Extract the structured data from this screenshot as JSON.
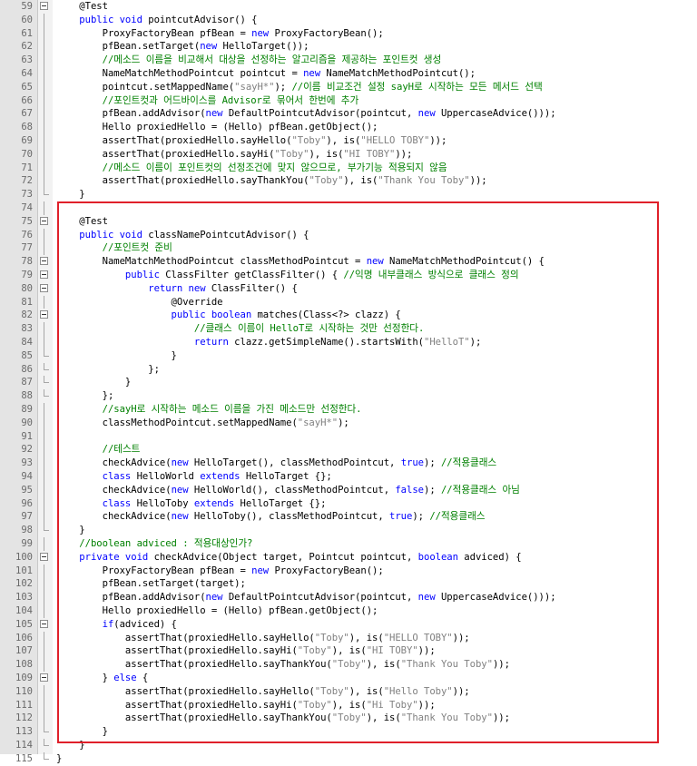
{
  "editor": {
    "highlight_color": "#e0202a",
    "colors": {
      "keyword": "#0000ff",
      "string": "#808080",
      "comment": "#008000",
      "gutter": "#e4e4e4"
    },
    "lines": [
      {
        "n": "59",
        "fold": "mark",
        "t": [
          [
            "ann",
            "    @Test"
          ]
        ]
      },
      {
        "n": "60",
        "fold": "line",
        "t": [
          [
            "kw",
            "    public void "
          ],
          [
            "plain",
            "pointcutAdvisor() {"
          ]
        ]
      },
      {
        "n": "61",
        "fold": "line",
        "t": [
          [
            "plain",
            "        ProxyFactoryBean pfBean = "
          ],
          [
            "kw",
            "new "
          ],
          [
            "plain",
            "ProxyFactoryBean();"
          ]
        ]
      },
      {
        "n": "62",
        "fold": "line",
        "t": [
          [
            "plain",
            "        pfBean.setTarget("
          ],
          [
            "kw",
            "new "
          ],
          [
            "plain",
            "HelloTarget());"
          ]
        ]
      },
      {
        "n": "63",
        "fold": "line",
        "t": [
          [
            "cmt",
            "        //메소드 이름을 비교해서 대상을 선정하는 알고리즘을 제공하는 포인트컷 생성"
          ]
        ]
      },
      {
        "n": "64",
        "fold": "line",
        "t": [
          [
            "plain",
            "        NameMatchMethodPointcut pointcut = "
          ],
          [
            "kw",
            "new "
          ],
          [
            "plain",
            "NameMatchMethodPointcut();"
          ]
        ]
      },
      {
        "n": "65",
        "fold": "line",
        "t": [
          [
            "plain",
            "        pointcut.setMappedName("
          ],
          [
            "str",
            "\"sayH*\""
          ],
          [
            "plain",
            "); "
          ],
          [
            "cmt",
            "//이름 비교조건 설정 sayH로 시작하는 모든 메서드 선택"
          ]
        ]
      },
      {
        "n": "66",
        "fold": "line",
        "t": [
          [
            "cmt",
            "        //포인트컷과 어드바이스를 Advisor로 묶어서 한번에 추가"
          ]
        ]
      },
      {
        "n": "67",
        "fold": "line",
        "t": [
          [
            "plain",
            "        pfBean.addAdvisor("
          ],
          [
            "kw",
            "new "
          ],
          [
            "plain",
            "DefaultPointcutAdvisor(pointcut, "
          ],
          [
            "kw",
            "new "
          ],
          [
            "plain",
            "UppercaseAdvice()));"
          ]
        ]
      },
      {
        "n": "68",
        "fold": "line",
        "t": [
          [
            "plain",
            "        Hello proxiedHello = (Hello) pfBean.getObject();"
          ]
        ]
      },
      {
        "n": "69",
        "fold": "line",
        "t": [
          [
            "plain",
            "        assertThat(proxiedHello.sayHello("
          ],
          [
            "str",
            "\"Toby\""
          ],
          [
            "plain",
            "), is("
          ],
          [
            "str",
            "\"HELLO TOBY\""
          ],
          [
            "plain",
            "));"
          ]
        ]
      },
      {
        "n": "70",
        "fold": "line",
        "t": [
          [
            "plain",
            "        assertThat(proxiedHello.sayHi("
          ],
          [
            "str",
            "\"Toby\""
          ],
          [
            "plain",
            "), is("
          ],
          [
            "str",
            "\"HI TOBY\""
          ],
          [
            "plain",
            "));"
          ]
        ]
      },
      {
        "n": "71",
        "fold": "line",
        "t": [
          [
            "cmt",
            "        //메소드 이름이 포인트컷의 선정조건에 맞지 않으므로, 부가기능 적용되지 않음"
          ]
        ]
      },
      {
        "n": "72",
        "fold": "line",
        "t": [
          [
            "plain",
            "        assertThat(proxiedHello.sayThankYou("
          ],
          [
            "str",
            "\"Toby\""
          ],
          [
            "plain",
            "), is("
          ],
          [
            "str",
            "\"Thank You Toby\""
          ],
          [
            "plain",
            "));"
          ]
        ]
      },
      {
        "n": "73",
        "fold": "end",
        "t": [
          [
            "plain",
            "    }"
          ]
        ]
      },
      {
        "n": "74",
        "fold": "line",
        "t": []
      },
      {
        "n": "75",
        "fold": "mark",
        "t": [
          [
            "ann",
            "    @Test"
          ]
        ]
      },
      {
        "n": "76",
        "fold": "line",
        "t": [
          [
            "kw",
            "    public void "
          ],
          [
            "plain",
            "classNamePointcutAdvisor() {"
          ]
        ]
      },
      {
        "n": "77",
        "fold": "line",
        "t": [
          [
            "cmt",
            "        //포인트컷 준비"
          ]
        ]
      },
      {
        "n": "78",
        "fold": "mark",
        "t": [
          [
            "plain",
            "        NameMatchMethodPointcut classMethodPointcut = "
          ],
          [
            "kw",
            "new "
          ],
          [
            "plain",
            "NameMatchMethodPointcut() {"
          ]
        ]
      },
      {
        "n": "79",
        "fold": "mark",
        "t": [
          [
            "kw",
            "            public "
          ],
          [
            "plain",
            "ClassFilter getClassFilter() { "
          ],
          [
            "cmt",
            "//익명 내부클래스 방식으로 클래스 정의"
          ]
        ]
      },
      {
        "n": "80",
        "fold": "mark",
        "t": [
          [
            "kw",
            "                return new "
          ],
          [
            "plain",
            "ClassFilter() {"
          ]
        ]
      },
      {
        "n": "81",
        "fold": "line",
        "t": [
          [
            "ann",
            "                    @Override"
          ]
        ]
      },
      {
        "n": "82",
        "fold": "mark",
        "t": [
          [
            "kw",
            "                    public boolean "
          ],
          [
            "plain",
            "matches(Class<?> clazz) {"
          ]
        ]
      },
      {
        "n": "83",
        "fold": "line",
        "t": [
          [
            "cmt",
            "                        //클래스 이름이 HelloT로 시작하는 것만 선정한다."
          ]
        ]
      },
      {
        "n": "84",
        "fold": "line",
        "t": [
          [
            "kw",
            "                        return "
          ],
          [
            "plain",
            "clazz.getSimpleName().startsWith("
          ],
          [
            "str",
            "\"HelloT\""
          ],
          [
            "plain",
            ");"
          ]
        ]
      },
      {
        "n": "85",
        "fold": "end",
        "t": [
          [
            "plain",
            "                    }"
          ]
        ]
      },
      {
        "n": "86",
        "fold": "end",
        "t": [
          [
            "plain",
            "                };"
          ]
        ]
      },
      {
        "n": "87",
        "fold": "end",
        "t": [
          [
            "plain",
            "            }"
          ]
        ]
      },
      {
        "n": "88",
        "fold": "end",
        "t": [
          [
            "plain",
            "        };"
          ]
        ]
      },
      {
        "n": "89",
        "fold": "line",
        "t": [
          [
            "cmt",
            "        //sayH로 시작하는 메소드 이름을 가진 메소드만 선정한다."
          ]
        ]
      },
      {
        "n": "90",
        "fold": "line",
        "t": [
          [
            "plain",
            "        classMethodPointcut.setMappedName("
          ],
          [
            "str",
            "\"sayH*\""
          ],
          [
            "plain",
            ");"
          ]
        ]
      },
      {
        "n": "91",
        "fold": "line",
        "t": []
      },
      {
        "n": "92",
        "fold": "line",
        "t": [
          [
            "cmt",
            "        //테스트"
          ]
        ]
      },
      {
        "n": "93",
        "fold": "line",
        "t": [
          [
            "plain",
            "        checkAdvice("
          ],
          [
            "kw",
            "new "
          ],
          [
            "plain",
            "HelloTarget(), classMethodPointcut, "
          ],
          [
            "kw",
            "true"
          ],
          [
            "plain",
            "); "
          ],
          [
            "cmt",
            "//적용클래스"
          ]
        ]
      },
      {
        "n": "94",
        "fold": "line",
        "t": [
          [
            "kw",
            "        class "
          ],
          [
            "plain",
            "HelloWorld "
          ],
          [
            "kw",
            "extends "
          ],
          [
            "plain",
            "HelloTarget {};"
          ]
        ]
      },
      {
        "n": "95",
        "fold": "line",
        "t": [
          [
            "plain",
            "        checkAdvice("
          ],
          [
            "kw",
            "new "
          ],
          [
            "plain",
            "HelloWorld(), classMethodPointcut, "
          ],
          [
            "kw",
            "false"
          ],
          [
            "plain",
            "); "
          ],
          [
            "cmt",
            "//적용클래스 아님"
          ]
        ]
      },
      {
        "n": "96",
        "fold": "line",
        "t": [
          [
            "kw",
            "        class "
          ],
          [
            "plain",
            "HelloToby "
          ],
          [
            "kw",
            "extends "
          ],
          [
            "plain",
            "HelloTarget {};"
          ]
        ]
      },
      {
        "n": "97",
        "fold": "line",
        "t": [
          [
            "plain",
            "        checkAdvice("
          ],
          [
            "kw",
            "new "
          ],
          [
            "plain",
            "HelloToby(), classMethodPointcut, "
          ],
          [
            "kw",
            "true"
          ],
          [
            "plain",
            "); "
          ],
          [
            "cmt",
            "//적용클래스"
          ]
        ]
      },
      {
        "n": "98",
        "fold": "end",
        "t": [
          [
            "plain",
            "    }"
          ]
        ]
      },
      {
        "n": "99",
        "fold": "line",
        "t": [
          [
            "cmt",
            "    //boolean adviced : 적용대상인가?"
          ]
        ]
      },
      {
        "n": "100",
        "fold": "mark",
        "t": [
          [
            "kw",
            "    private void "
          ],
          [
            "plain",
            "checkAdvice(Object target, Pointcut pointcut, "
          ],
          [
            "kw",
            "boolean "
          ],
          [
            "plain",
            "adviced) {"
          ]
        ]
      },
      {
        "n": "101",
        "fold": "line",
        "t": [
          [
            "plain",
            "        ProxyFactoryBean pfBean = "
          ],
          [
            "kw",
            "new "
          ],
          [
            "plain",
            "ProxyFactoryBean();"
          ]
        ]
      },
      {
        "n": "102",
        "fold": "line",
        "t": [
          [
            "plain",
            "        pfBean.setTarget(target);"
          ]
        ]
      },
      {
        "n": "103",
        "fold": "line",
        "t": [
          [
            "plain",
            "        pfBean.addAdvisor("
          ],
          [
            "kw",
            "new "
          ],
          [
            "plain",
            "DefaultPointcutAdvisor(pointcut, "
          ],
          [
            "kw",
            "new "
          ],
          [
            "plain",
            "UppercaseAdvice()));"
          ]
        ]
      },
      {
        "n": "104",
        "fold": "line",
        "t": [
          [
            "plain",
            "        Hello proxiedHello = (Hello) pfBean.getObject();"
          ]
        ]
      },
      {
        "n": "105",
        "fold": "mark",
        "t": [
          [
            "kw",
            "        if"
          ],
          [
            "plain",
            "(adviced) {"
          ]
        ]
      },
      {
        "n": "106",
        "fold": "line",
        "t": [
          [
            "plain",
            "            assertThat(proxiedHello.sayHello("
          ],
          [
            "str",
            "\"Toby\""
          ],
          [
            "plain",
            "), is("
          ],
          [
            "str",
            "\"HELLO TOBY\""
          ],
          [
            "plain",
            "));"
          ]
        ]
      },
      {
        "n": "107",
        "fold": "line",
        "t": [
          [
            "plain",
            "            assertThat(proxiedHello.sayHi("
          ],
          [
            "str",
            "\"Toby\""
          ],
          [
            "plain",
            "), is("
          ],
          [
            "str",
            "\"HI TOBY\""
          ],
          [
            "plain",
            "));"
          ]
        ]
      },
      {
        "n": "108",
        "fold": "line",
        "t": [
          [
            "plain",
            "            assertThat(proxiedHello.sayThankYou("
          ],
          [
            "str",
            "\"Toby\""
          ],
          [
            "plain",
            "), is("
          ],
          [
            "str",
            "\"Thank You Toby\""
          ],
          [
            "plain",
            "));"
          ]
        ]
      },
      {
        "n": "109",
        "fold": "mark",
        "t": [
          [
            "plain",
            "        } "
          ],
          [
            "kw",
            "else "
          ],
          [
            "plain",
            "{"
          ]
        ]
      },
      {
        "n": "110",
        "fold": "line",
        "t": [
          [
            "plain",
            "            assertThat(proxiedHello.sayHello("
          ],
          [
            "str",
            "\"Toby\""
          ],
          [
            "plain",
            "), is("
          ],
          [
            "str",
            "\"Hello Toby\""
          ],
          [
            "plain",
            "));"
          ]
        ]
      },
      {
        "n": "111",
        "fold": "line",
        "t": [
          [
            "plain",
            "            assertThat(proxiedHello.sayHi("
          ],
          [
            "str",
            "\"Toby\""
          ],
          [
            "plain",
            "), is("
          ],
          [
            "str",
            "\"Hi Toby\""
          ],
          [
            "plain",
            "));"
          ]
        ]
      },
      {
        "n": "112",
        "fold": "line",
        "t": [
          [
            "plain",
            "            assertThat(proxiedHello.sayThankYou("
          ],
          [
            "str",
            "\"Toby\""
          ],
          [
            "plain",
            "), is("
          ],
          [
            "str",
            "\"Thank You Toby\""
          ],
          [
            "plain",
            "));"
          ]
        ]
      },
      {
        "n": "113",
        "fold": "end",
        "t": [
          [
            "plain",
            "        }"
          ]
        ]
      },
      {
        "n": "114",
        "fold": "end",
        "t": [
          [
            "plain",
            "    }"
          ]
        ]
      },
      {
        "n": "115",
        "fold": "end",
        "t": [
          [
            "plain",
            "}"
          ]
        ]
      }
    ]
  }
}
